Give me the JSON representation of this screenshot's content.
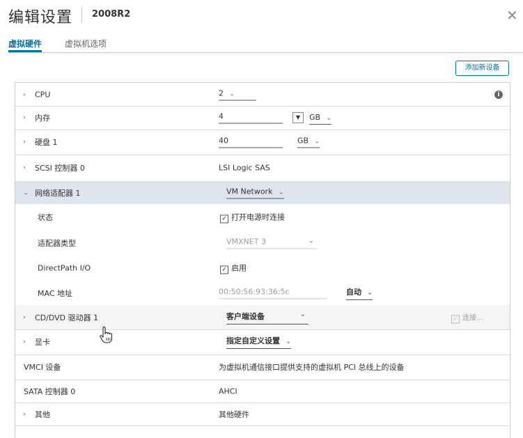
{
  "header": {
    "title": "编辑设置",
    "subtitle": "2008R2",
    "close_icon": "close-icon"
  },
  "tabs": [
    {
      "label": "虚拟硬件",
      "active": true
    },
    {
      "label": "虚拟机选项",
      "active": false
    }
  ],
  "toolbar": {
    "add_device_label": "添加新设备"
  },
  "rows": {
    "cpu": {
      "label": "CPU",
      "value": "2"
    },
    "memory": {
      "label": "内存",
      "value": "4",
      "unit": "GB"
    },
    "disk": {
      "label": "硬盘 1",
      "value": "40",
      "unit": "GB"
    },
    "scsi": {
      "label": "SCSI 控制器 0",
      "value": "LSI Logic SAS"
    },
    "nic": {
      "label": "网络适配器 1",
      "value": "VM Network"
    },
    "status": {
      "label": "状态",
      "value": "打开电源时连接"
    },
    "adapter": {
      "label": "适配器类型",
      "value": "VMXNET 3"
    },
    "directpath": {
      "label": "DirectPath I/O",
      "value": "启用"
    },
    "mac": {
      "label": "MAC 地址",
      "value": "00:50:56:93:36:5c",
      "mode": "自动"
    },
    "cd": {
      "label": "CD/DVD 驱动器 1",
      "value": "客户端设备",
      "connect": "连接..."
    },
    "video": {
      "label": "显卡",
      "value": "指定自定义设置"
    },
    "vmci": {
      "label": "VMCI 设备",
      "value": "为虚拟机通信接口提供支持的虚拟机 PCI 总线上的设备"
    },
    "sata": {
      "label": "SATA 控制器 0",
      "value": "AHCI"
    },
    "other": {
      "label": "其他",
      "value": "其他硬件"
    }
  },
  "colors": {
    "accent": "#0072a3",
    "highlight_row": "#dfe5ec"
  }
}
